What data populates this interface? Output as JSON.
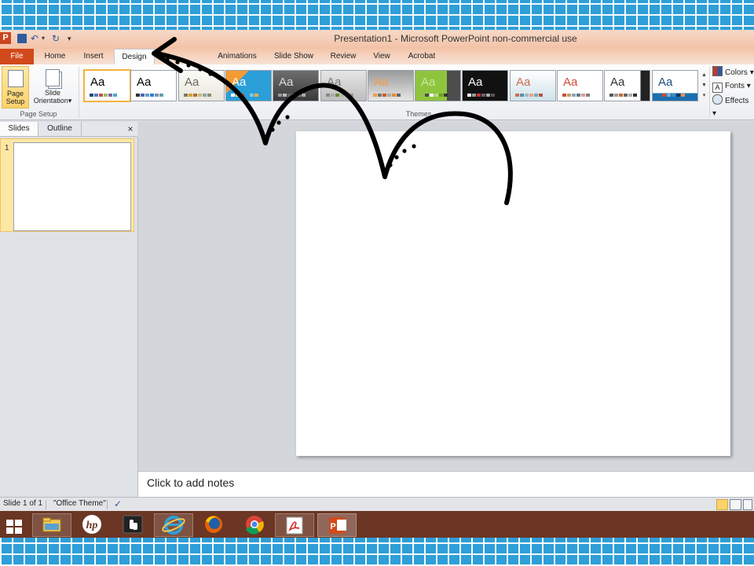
{
  "window": {
    "title": "Presentation1  -  Microsoft PowerPoint non-commercial use"
  },
  "quick_access": {
    "icons": [
      "powerpoint-icon",
      "save-icon",
      "undo-icon",
      "redo-icon",
      "customize-icon"
    ]
  },
  "tabs": [
    "File",
    "Home",
    "Insert",
    "Design",
    "Animations",
    "Slide Show",
    "Review",
    "View",
    "Acrobat"
  ],
  "active_tab": "Design",
  "ribbon": {
    "page_setup": {
      "page_setup_label_1": "Page",
      "page_setup_label_2": "Setup",
      "orientation_label_1": "Slide",
      "orientation_label_2": "Orientation",
      "orientation_caret": "▾",
      "group_label": "Page Setup"
    },
    "themes": {
      "group_label": "Themes",
      "sample_text": "Aa",
      "count": 13
    },
    "right": {
      "colors": "Colors",
      "fonts": "Fonts",
      "effects": "Effects",
      "caret": "▾"
    }
  },
  "left_panel": {
    "tab_slides": "Slides",
    "tab_outline": "Outline",
    "close": "×",
    "thumb_number": "1"
  },
  "notes": {
    "placeholder": "Click to add notes"
  },
  "status": {
    "slide_info": "Slide 1 of 1",
    "theme": "\"Office Theme\""
  },
  "taskbar": {
    "apps": [
      "windows-start",
      "file-explorer",
      "hp",
      "touch-app",
      "internet-explorer",
      "firefox",
      "chrome",
      "acrobat",
      "powerpoint"
    ]
  },
  "colors": {
    "file_tab": "#d24a1b",
    "title_bar": "#f3c2a6",
    "taskbar": "#6b3624",
    "page_background": "#2e9fd8",
    "selection": "#fbd26b"
  }
}
